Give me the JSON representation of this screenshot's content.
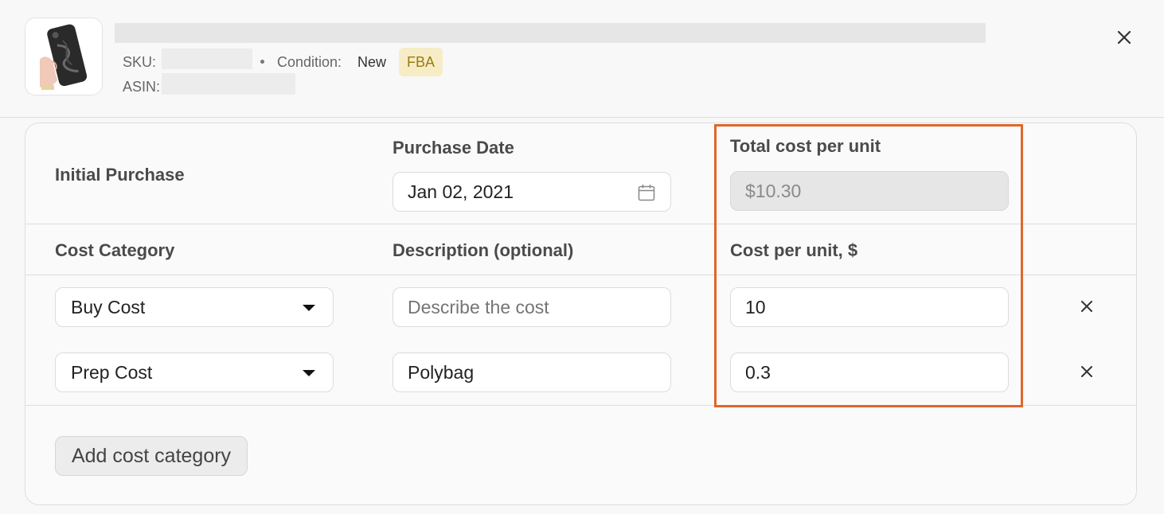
{
  "header": {
    "sku_label": "SKU:",
    "condition_label": "Condition:",
    "condition_value": "New",
    "fulfillment_badge": "FBA",
    "asin_label": "ASIN:",
    "close_icon": "close-icon"
  },
  "purchase": {
    "section_label": "Initial Purchase",
    "date_label": "Purchase Date",
    "date_value": "Jan 02, 2021",
    "total_label": "Total cost per unit",
    "total_value": "$10.30"
  },
  "columns": {
    "category": "Cost Category",
    "description": "Description (optional)",
    "cost": "Cost per unit, $"
  },
  "cost_rows": [
    {
      "category": "Buy Cost",
      "description": "",
      "description_placeholder": "Describe the cost",
      "cost": "10"
    },
    {
      "category": "Prep Cost",
      "description": "Polybag",
      "description_placeholder": "Describe the cost",
      "cost": "0.3"
    }
  ],
  "actions": {
    "add_category": "Add cost category"
  },
  "colors": {
    "highlight": "#e0662a",
    "badge_bg": "#f6edc6",
    "badge_text": "#9a7b10"
  }
}
